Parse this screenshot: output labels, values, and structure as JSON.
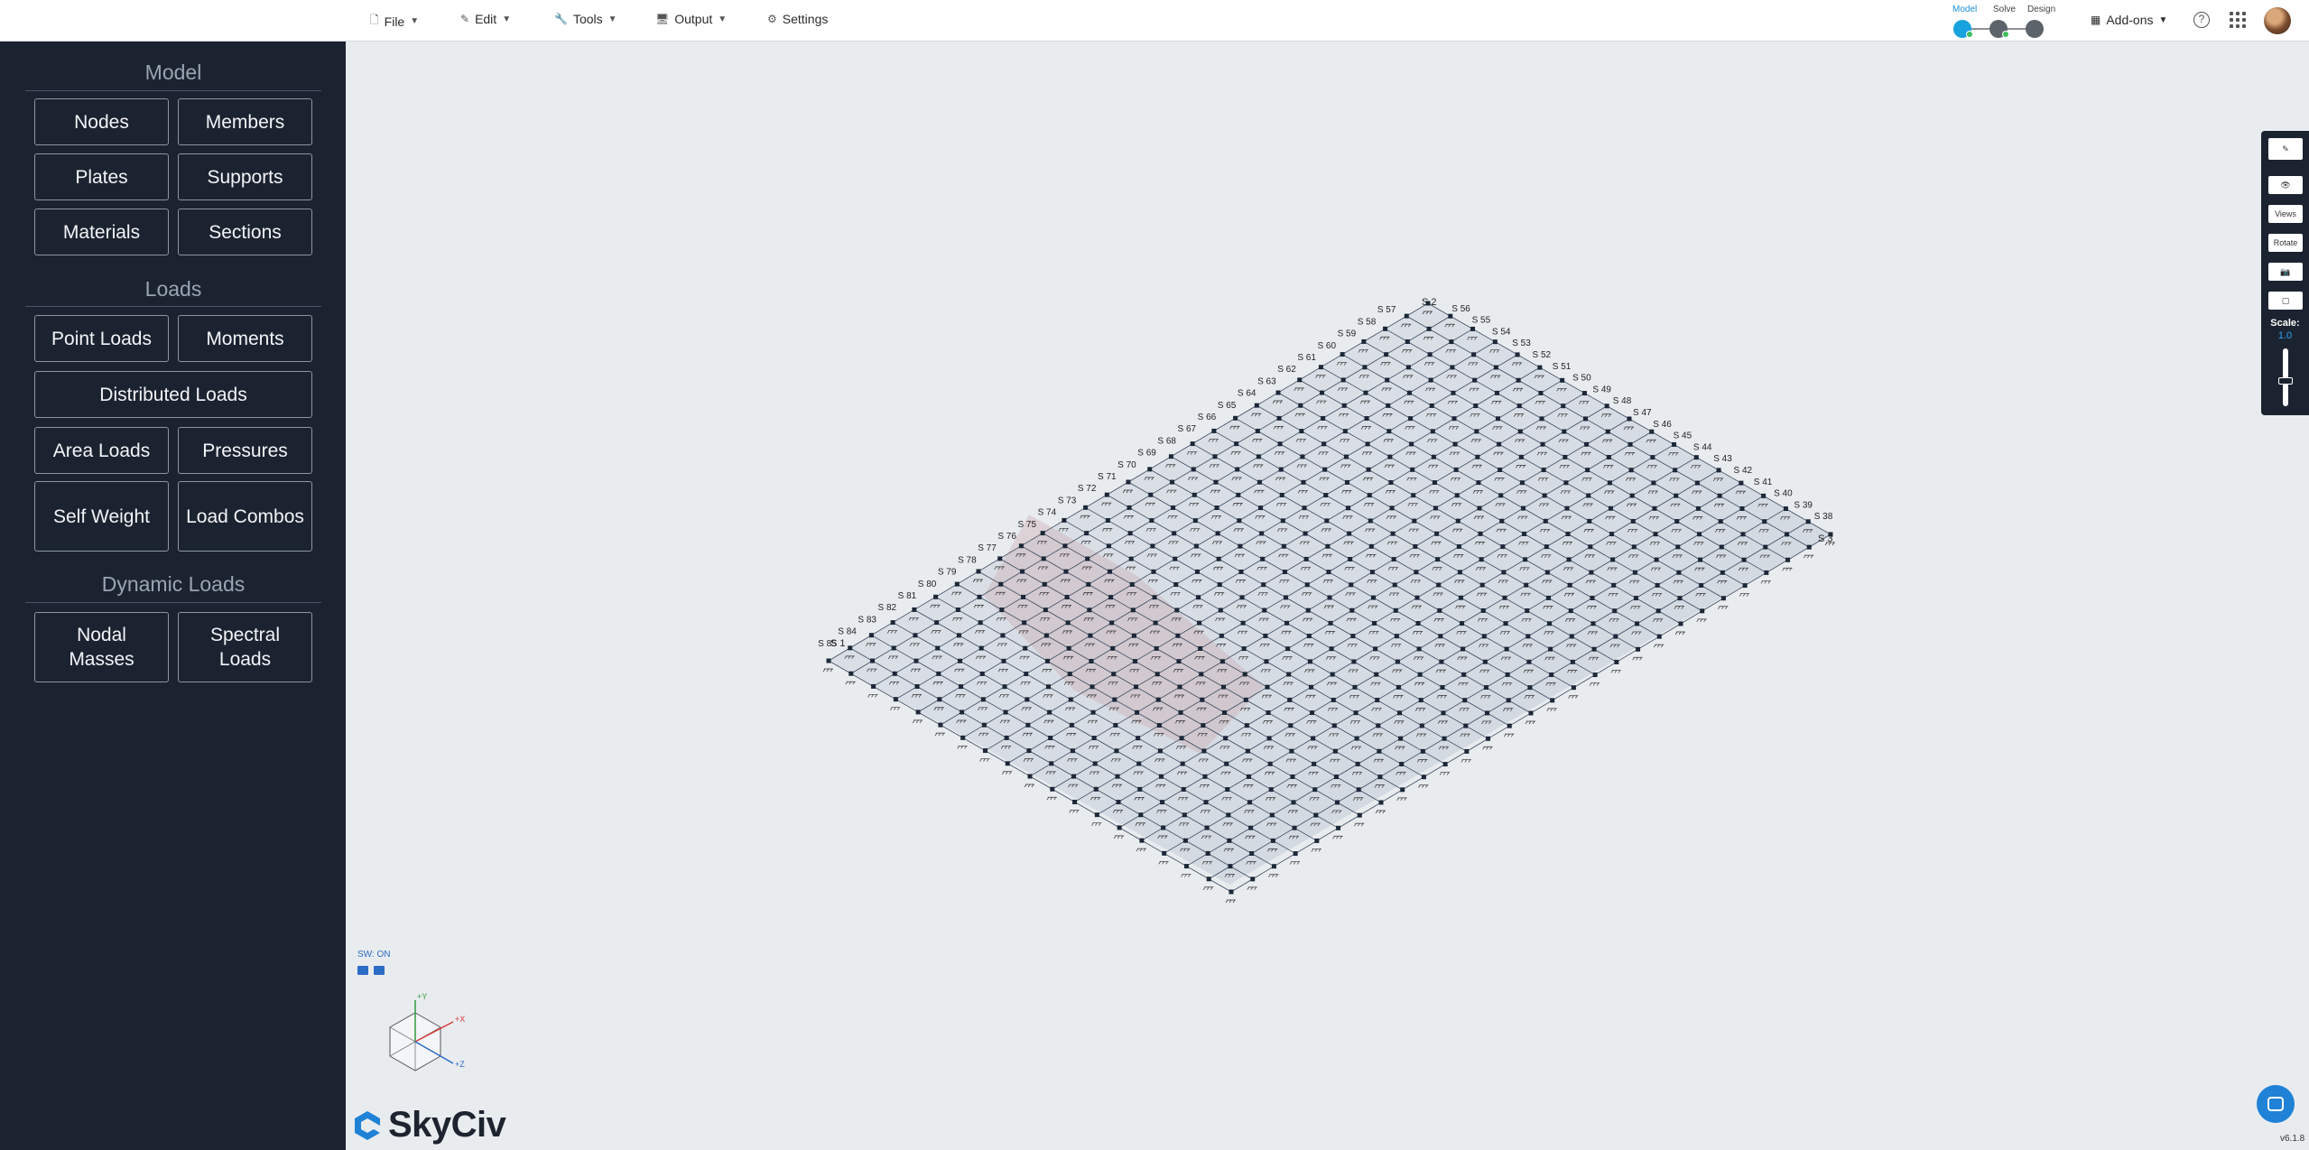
{
  "menu": {
    "file": "File",
    "edit": "Edit",
    "tools": "Tools",
    "output": "Output",
    "settings": "Settings"
  },
  "stages": {
    "model": "Model",
    "solve": "Solve",
    "design": "Design"
  },
  "topbar_right": {
    "addons": "Add-ons",
    "help": "?"
  },
  "sidebar": {
    "model_title": "Model",
    "nodes": "Nodes",
    "members": "Members",
    "plates": "Plates",
    "supports": "Supports",
    "materials": "Materials",
    "sections": "Sections",
    "loads_title": "Loads",
    "point_loads": "Point Loads",
    "moments": "Moments",
    "distributed_loads": "Distributed Loads",
    "area_loads": "Area Loads",
    "pressures": "Pressures",
    "self_weight": "Self Weight",
    "load_combos": "Load Combos",
    "dynamic_title": "Dynamic Loads",
    "nodal_masses": "Nodal Masses",
    "spectral_loads": "Spectral Loads"
  },
  "toolbar_right": {
    "views": "Views",
    "rotate": "Rotate",
    "scale_label": "Scale:",
    "scale_value": "1.0"
  },
  "viewport": {
    "sw_status": "SW: ON",
    "axis_x": "+X",
    "axis_y": "+Y",
    "axis_z": "+Z",
    "support_labels": {
      "top": "S 2",
      "left": "S 1",
      "right": "S 3",
      "top_row": [
        "S 56",
        "S 55",
        "S 54",
        "S 53",
        "S 52",
        "S 51",
        "S 50",
        "S 49",
        "S 48",
        "S 47",
        "S 46",
        "S 45",
        "S 44",
        "S 43",
        "S 42",
        "S 41",
        "S 40",
        "S 39",
        "S 38"
      ],
      "left_row": [
        "S 57",
        "S 58",
        "S 59",
        "S 60",
        "S 61",
        "S 62",
        "S 63",
        "S 64",
        "S 65",
        "S 66",
        "S 67",
        "S 68",
        "S 69",
        "S 70",
        "S 71",
        "S 72",
        "S 73",
        "S 74",
        "S 75",
        "S 76",
        "S 77",
        "S 78",
        "S 79",
        "S 80",
        "S 81",
        "S 82",
        "S 83",
        "S 84",
        "S 85"
      ]
    }
  },
  "brand": {
    "logo": "SkyCiv"
  },
  "footer": {
    "version": "v6.1.8"
  },
  "colors": {
    "sidebar_bg": "#1c2330",
    "accent": "#1a8fd6",
    "viewport_bg": "#e9ecef"
  }
}
